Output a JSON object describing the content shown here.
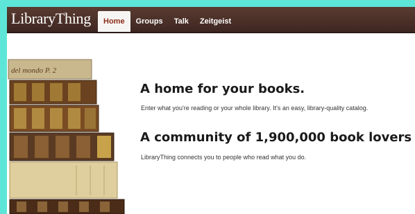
{
  "header": {
    "logo_text": "LibraryThing",
    "tabs": [
      {
        "label": "Home",
        "active": true
      },
      {
        "label": "Groups",
        "active": false
      },
      {
        "label": "Talk",
        "active": false
      },
      {
        "label": "Zeitgeist",
        "active": false
      }
    ]
  },
  "main": {
    "heading1": "A home for your books.",
    "text1": "Enter what you're reading or your whole library. It's an easy, library-quality catalog.",
    "heading2": "A community of 1,900,000 book lovers",
    "text2": "LibraryThing connects you to people who read what you do."
  },
  "books_image": {
    "spine_text_top": "del mondo  P. 2"
  },
  "colors": {
    "nav_bg": "#4a2f27",
    "active_tab_text": "#8b2c1a",
    "page_bg": "#ffffff",
    "outer_bg": "#5de6d8"
  }
}
